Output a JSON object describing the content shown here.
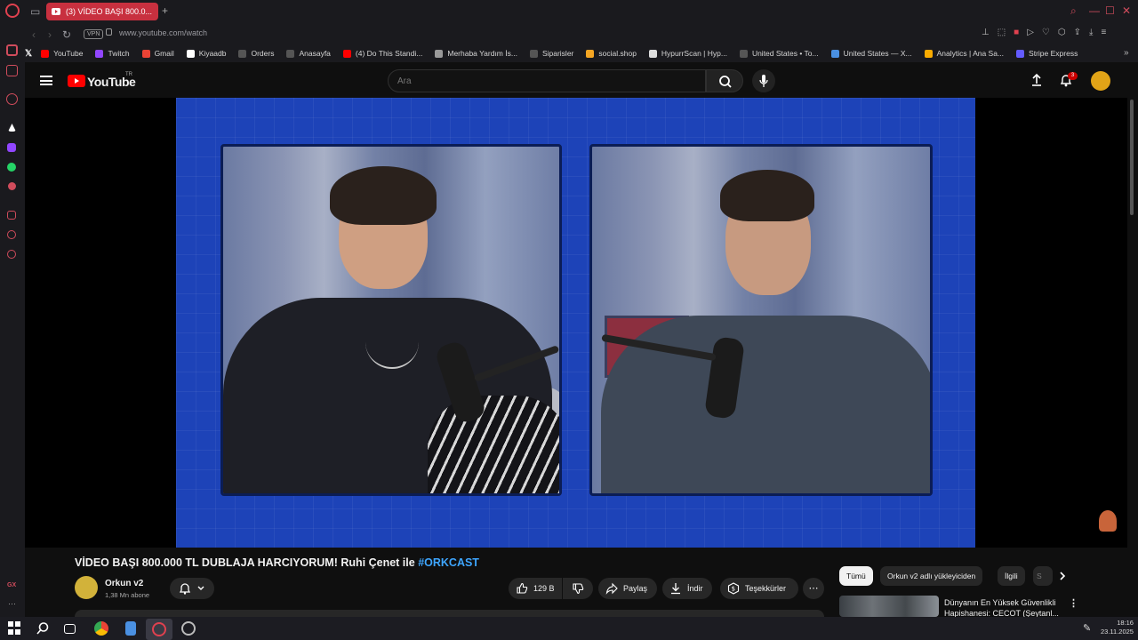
{
  "browser": {
    "tab_title": "(3) VİDEO BAŞI 800.0...",
    "url": "www.youtube.com/watch",
    "vpn_label": "VPN"
  },
  "bookmarks": [
    {
      "label": "YouTube",
      "icon": "youtube-icon",
      "color": "#ff0000"
    },
    {
      "label": "Twitch",
      "icon": "twitch-icon",
      "color": "#9146ff"
    },
    {
      "label": "Gmail",
      "icon": "gmail-icon",
      "color": "#ea4335"
    },
    {
      "label": "Kiyaadb",
      "icon": "kiyaadb-icon",
      "color": "#ffffff"
    },
    {
      "label": "Orders",
      "icon": "orders-icon",
      "color": "#555555"
    },
    {
      "label": "Anasayfa",
      "icon": "anasayfa-icon",
      "color": "#555555"
    },
    {
      "label": "(4) Do This Standi...",
      "icon": "youtube-icon",
      "color": "#ff0000"
    },
    {
      "label": "Merhaba Yardım İs...",
      "icon": "help-icon",
      "color": "#999999"
    },
    {
      "label": "Siparisler",
      "icon": "orders-icon",
      "color": "#555555"
    },
    {
      "label": "social.shop",
      "icon": "social-shop-icon",
      "color": "#f5a623"
    },
    {
      "label": "HypurrScan | Hyp...",
      "icon": "hypurrscan-icon",
      "color": "#dddddd"
    },
    {
      "label": "United States • To...",
      "icon": "chart-icon",
      "color": "#555555"
    },
    {
      "label": "United States — X...",
      "icon": "globe-icon",
      "color": "#4a90e2"
    },
    {
      "label": "Analytics | Ana Sa...",
      "icon": "analytics-icon",
      "color": "#f9ab00"
    },
    {
      "label": "Stripe Express",
      "icon": "stripe-icon",
      "color": "#635bff"
    }
  ],
  "youtube": {
    "logo_text": "YouTube",
    "country_code": "TR",
    "search_placeholder": "Ara",
    "notification_count": "3"
  },
  "video": {
    "title_main": "VİDEO BAŞI 800.000 TL DUBLAJA HARCIYORUM! Ruhi Çenet ile ",
    "title_hashtag": "#ORKCAST",
    "channel_name": "Orkun v2",
    "subscribers": "1,38 Mn abone",
    "like_count": "129 B",
    "share_label": "Paylaş",
    "download_label": "İndir",
    "thanks_label": "Teşekkürler"
  },
  "recommend": {
    "chips": [
      "Tümü",
      "Orkun v2 adlı yükleyiciden",
      "İlgili",
      "S"
    ],
    "first_title": "Dünyanın En Yüksek Güvenlikli Hapishanesi: CECOT (Şeytanl..."
  },
  "taskbar": {
    "time": "18:16",
    "date": "23.11.2025"
  }
}
